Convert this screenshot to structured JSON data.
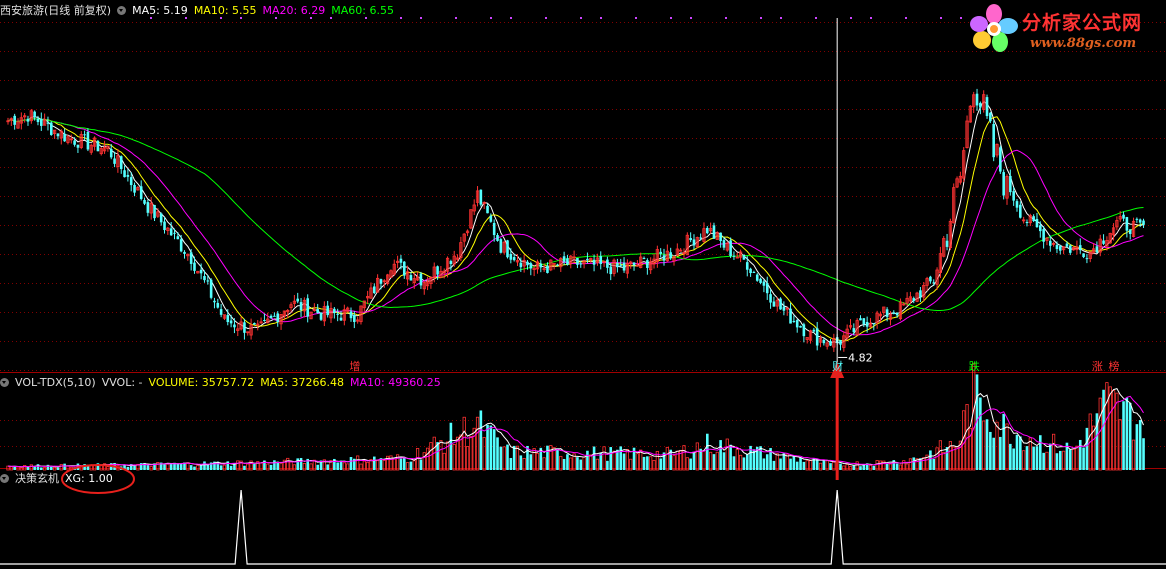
{
  "colors": {
    "up": "#ff3232",
    "down": "#54ffff",
    "ma5": "#ffffff",
    "ma10": "#ffff00",
    "ma20": "#ff00ff",
    "ma60": "#00ff00",
    "grid": "#800000",
    "vol_ma5": "#ffffff",
    "vol_ma10": "#ff00ff",
    "arrow": "#e8201c",
    "xg": "#ffffff"
  },
  "price_panel": {
    "title": "西安旅游(日线 前复权)",
    "ma5_label": "MA5: 5.19",
    "ma10_label": "MA10: 5.55",
    "ma20_label": "MA20: 6.29",
    "ma60_label": "MA60: 6.55",
    "low_marker_label": "4.82",
    "event_markers": [
      {
        "text": "增",
        "index": 104,
        "color": "#ff3232"
      },
      {
        "text": "财",
        "index": 249,
        "color": "#54ffff"
      },
      {
        "text": "跌",
        "index": 290,
        "color": "#00ff00"
      },
      {
        "text": "涨",
        "index": 327,
        "color": "#ff3232"
      },
      {
        "text": "榜",
        "index": 332,
        "color": "#ff3232"
      }
    ]
  },
  "volume_panel": {
    "indicator": "VOL-TDX(5,10)",
    "vvol_label": "VVOL: -",
    "volume_label": "VOLUME: 35757.72",
    "ma5_label": "MA5: 37266.48",
    "ma10_label": "MA10: 49360.25"
  },
  "signal_panel": {
    "indicator": "决策玄机",
    "xg_label": "XG: 1.00"
  },
  "logo": {
    "brand": "分析家公式网",
    "url": "www.88gs.com"
  },
  "chart_data": [
    {
      "type": "candlestick",
      "series_name": "西安旅游(日线 前复权)",
      "ylim": [
        4.6,
        10.6
      ],
      "description_points": [
        {
          "x": 0,
          "close": 8.8
        },
        {
          "x": 6,
          "close": 8.9
        },
        {
          "x": 18,
          "close": 8.5
        },
        {
          "x": 30,
          "close": 8.3
        },
        {
          "x": 42,
          "close": 7.3
        },
        {
          "x": 55,
          "close": 6.4
        },
        {
          "x": 65,
          "close": 5.3
        },
        {
          "x": 75,
          "close": 5.1
        },
        {
          "x": 85,
          "close": 5.6
        },
        {
          "x": 95,
          "close": 5.4
        },
        {
          "x": 105,
          "close": 5.4
        },
        {
          "x": 115,
          "close": 6.3
        },
        {
          "x": 125,
          "close": 6.0
        },
        {
          "x": 135,
          "close": 6.5
        },
        {
          "x": 141,
          "close": 7.5
        },
        {
          "x": 148,
          "close": 6.6
        },
        {
          "x": 158,
          "close": 6.2
        },
        {
          "x": 170,
          "close": 6.3
        },
        {
          "x": 185,
          "close": 6.2
        },
        {
          "x": 200,
          "close": 6.5
        },
        {
          "x": 210,
          "close": 6.9
        },
        {
          "x": 215,
          "close": 6.6
        },
        {
          "x": 222,
          "close": 6.3
        },
        {
          "x": 232,
          "close": 5.5
        },
        {
          "x": 242,
          "close": 5.0
        },
        {
          "x": 249,
          "close": 4.9
        },
        {
          "x": 258,
          "close": 5.3
        },
        {
          "x": 268,
          "close": 5.5
        },
        {
          "x": 278,
          "close": 6.0
        },
        {
          "x": 286,
          "close": 7.8
        },
        {
          "x": 290,
          "close": 9.6
        },
        {
          "x": 296,
          "close": 8.2
        },
        {
          "x": 305,
          "close": 7.1
        },
        {
          "x": 315,
          "close": 6.6
        },
        {
          "x": 325,
          "close": 6.5
        },
        {
          "x": 333,
          "close": 7.0
        },
        {
          "x": 341,
          "close": 6.9
        }
      ],
      "last": {
        "ma5": 5.19,
        "ma10": 5.55,
        "ma20": 6.29,
        "ma60": 6.55
      }
    },
    {
      "type": "bar",
      "series_name": "VOL-TDX(5,10)",
      "ylim": [
        0,
        60000
      ],
      "description_points": [
        {
          "x": 0,
          "value": 3000
        },
        {
          "x": 40,
          "value": 4000
        },
        {
          "x": 80,
          "value": 6000
        },
        {
          "x": 120,
          "value": 9000
        },
        {
          "x": 141,
          "value": 35000
        },
        {
          "x": 150,
          "value": 14000
        },
        {
          "x": 200,
          "value": 12000
        },
        {
          "x": 210,
          "value": 20000
        },
        {
          "x": 249,
          "value": 4000
        },
        {
          "x": 270,
          "value": 7000
        },
        {
          "x": 285,
          "value": 20000
        },
        {
          "x": 290,
          "value": 58000
        },
        {
          "x": 300,
          "value": 30000
        },
        {
          "x": 320,
          "value": 15000
        },
        {
          "x": 330,
          "value": 52000
        },
        {
          "x": 341,
          "value": 35757.72
        }
      ],
      "last": {
        "volume": 35757.72,
        "ma5": 37266.48,
        "ma10": 49360.25
      }
    },
    {
      "type": "line",
      "series_name": "XG",
      "ylim": [
        0,
        1
      ],
      "signal_indices": [
        70,
        249
      ],
      "last_value": 1.0
    }
  ]
}
